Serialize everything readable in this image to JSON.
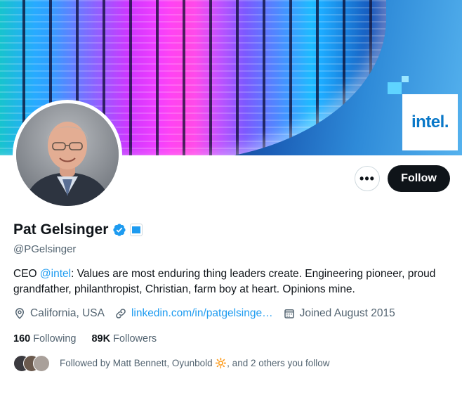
{
  "banner": {
    "brand_logo_text": "intel."
  },
  "actions": {
    "more_label": "•••",
    "follow_label": "Follow"
  },
  "profile": {
    "name": "Pat Gelsinger",
    "handle": "@PGelsinger",
    "bio_prefix": "CEO ",
    "bio_mention": "@intel",
    "bio_suffix": ": Values are most enduring thing leaders create. Engineering pioneer, proud grandfather, philanthropist, Christian, farm boy at heart. Opinions mine.",
    "location": "California, USA",
    "website": "linkedin.com/in/patgelsinge…",
    "joined": "Joined August 2015"
  },
  "stats": {
    "following_count": "160",
    "following_label": "Following",
    "followers_count": "89K",
    "followers_label": "Followers"
  },
  "followed_by": {
    "text": "Followed by Matt Bennett, Oyunbold 🔆, and 2 others you follow"
  },
  "colors": {
    "accent": "#1d9bf0",
    "text": "#0f1419",
    "muted": "#536471",
    "brand": "#0a78c8"
  },
  "icons": [
    "verified-badge-icon",
    "affiliate-badge-icon",
    "location-pin-icon",
    "link-icon",
    "calendar-icon",
    "more-dots-icon"
  ]
}
